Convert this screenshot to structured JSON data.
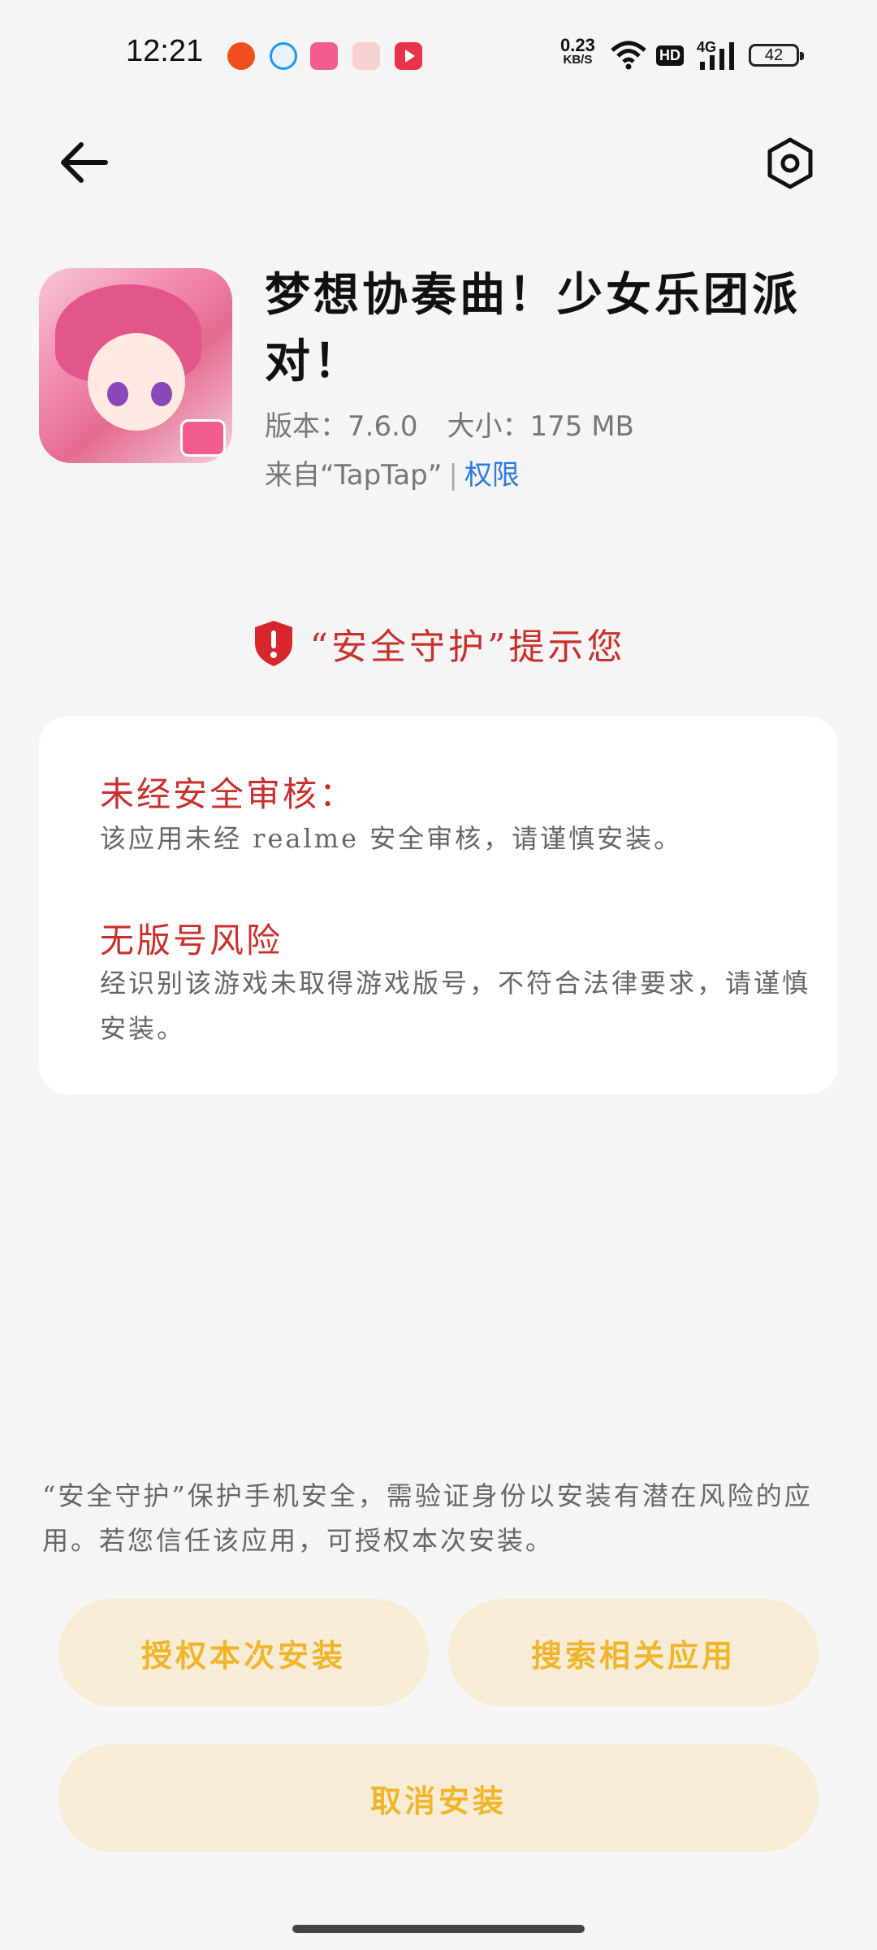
{
  "status_bar": {
    "time": "12:21",
    "net_speed_value": "0.23",
    "net_speed_unit": "KB/S",
    "hd_label": "HD",
    "network_label": "4G",
    "battery_level": "42"
  },
  "header": {
    "back_icon": "arrow-left-icon",
    "settings_icon": "settings-hexagon-icon"
  },
  "app": {
    "title": "梦想协奏曲！少女乐团派对！",
    "version": "版本：7.6.0",
    "size": "大小：175 MB",
    "source": "来自“TapTap”",
    "separator": "|",
    "permissions_link": "权限"
  },
  "warning": {
    "header": "“安全守护”提示您",
    "risks": [
      {
        "title": "未经安全审核：",
        "description": "该应用未经 realme 安全审核，请谨慎安装。"
      },
      {
        "title": "无版号风险",
        "description": "经识别该游戏未取得游戏版号，不符合法律要求，请谨慎安装。"
      }
    ]
  },
  "note": "“安全守护”保护手机安全，需验证身份以安装有潜在风险的应用。若您信任该应用，可授权本次安装。",
  "buttons": {
    "authorize": "授权本次安装",
    "search": "搜索相关应用",
    "cancel": "取消安装"
  },
  "colors": {
    "warning_red": "#c9302c",
    "link_blue": "#2a7ce0",
    "button_bg": "#f7ecd6",
    "button_text": "#f0b52a"
  }
}
